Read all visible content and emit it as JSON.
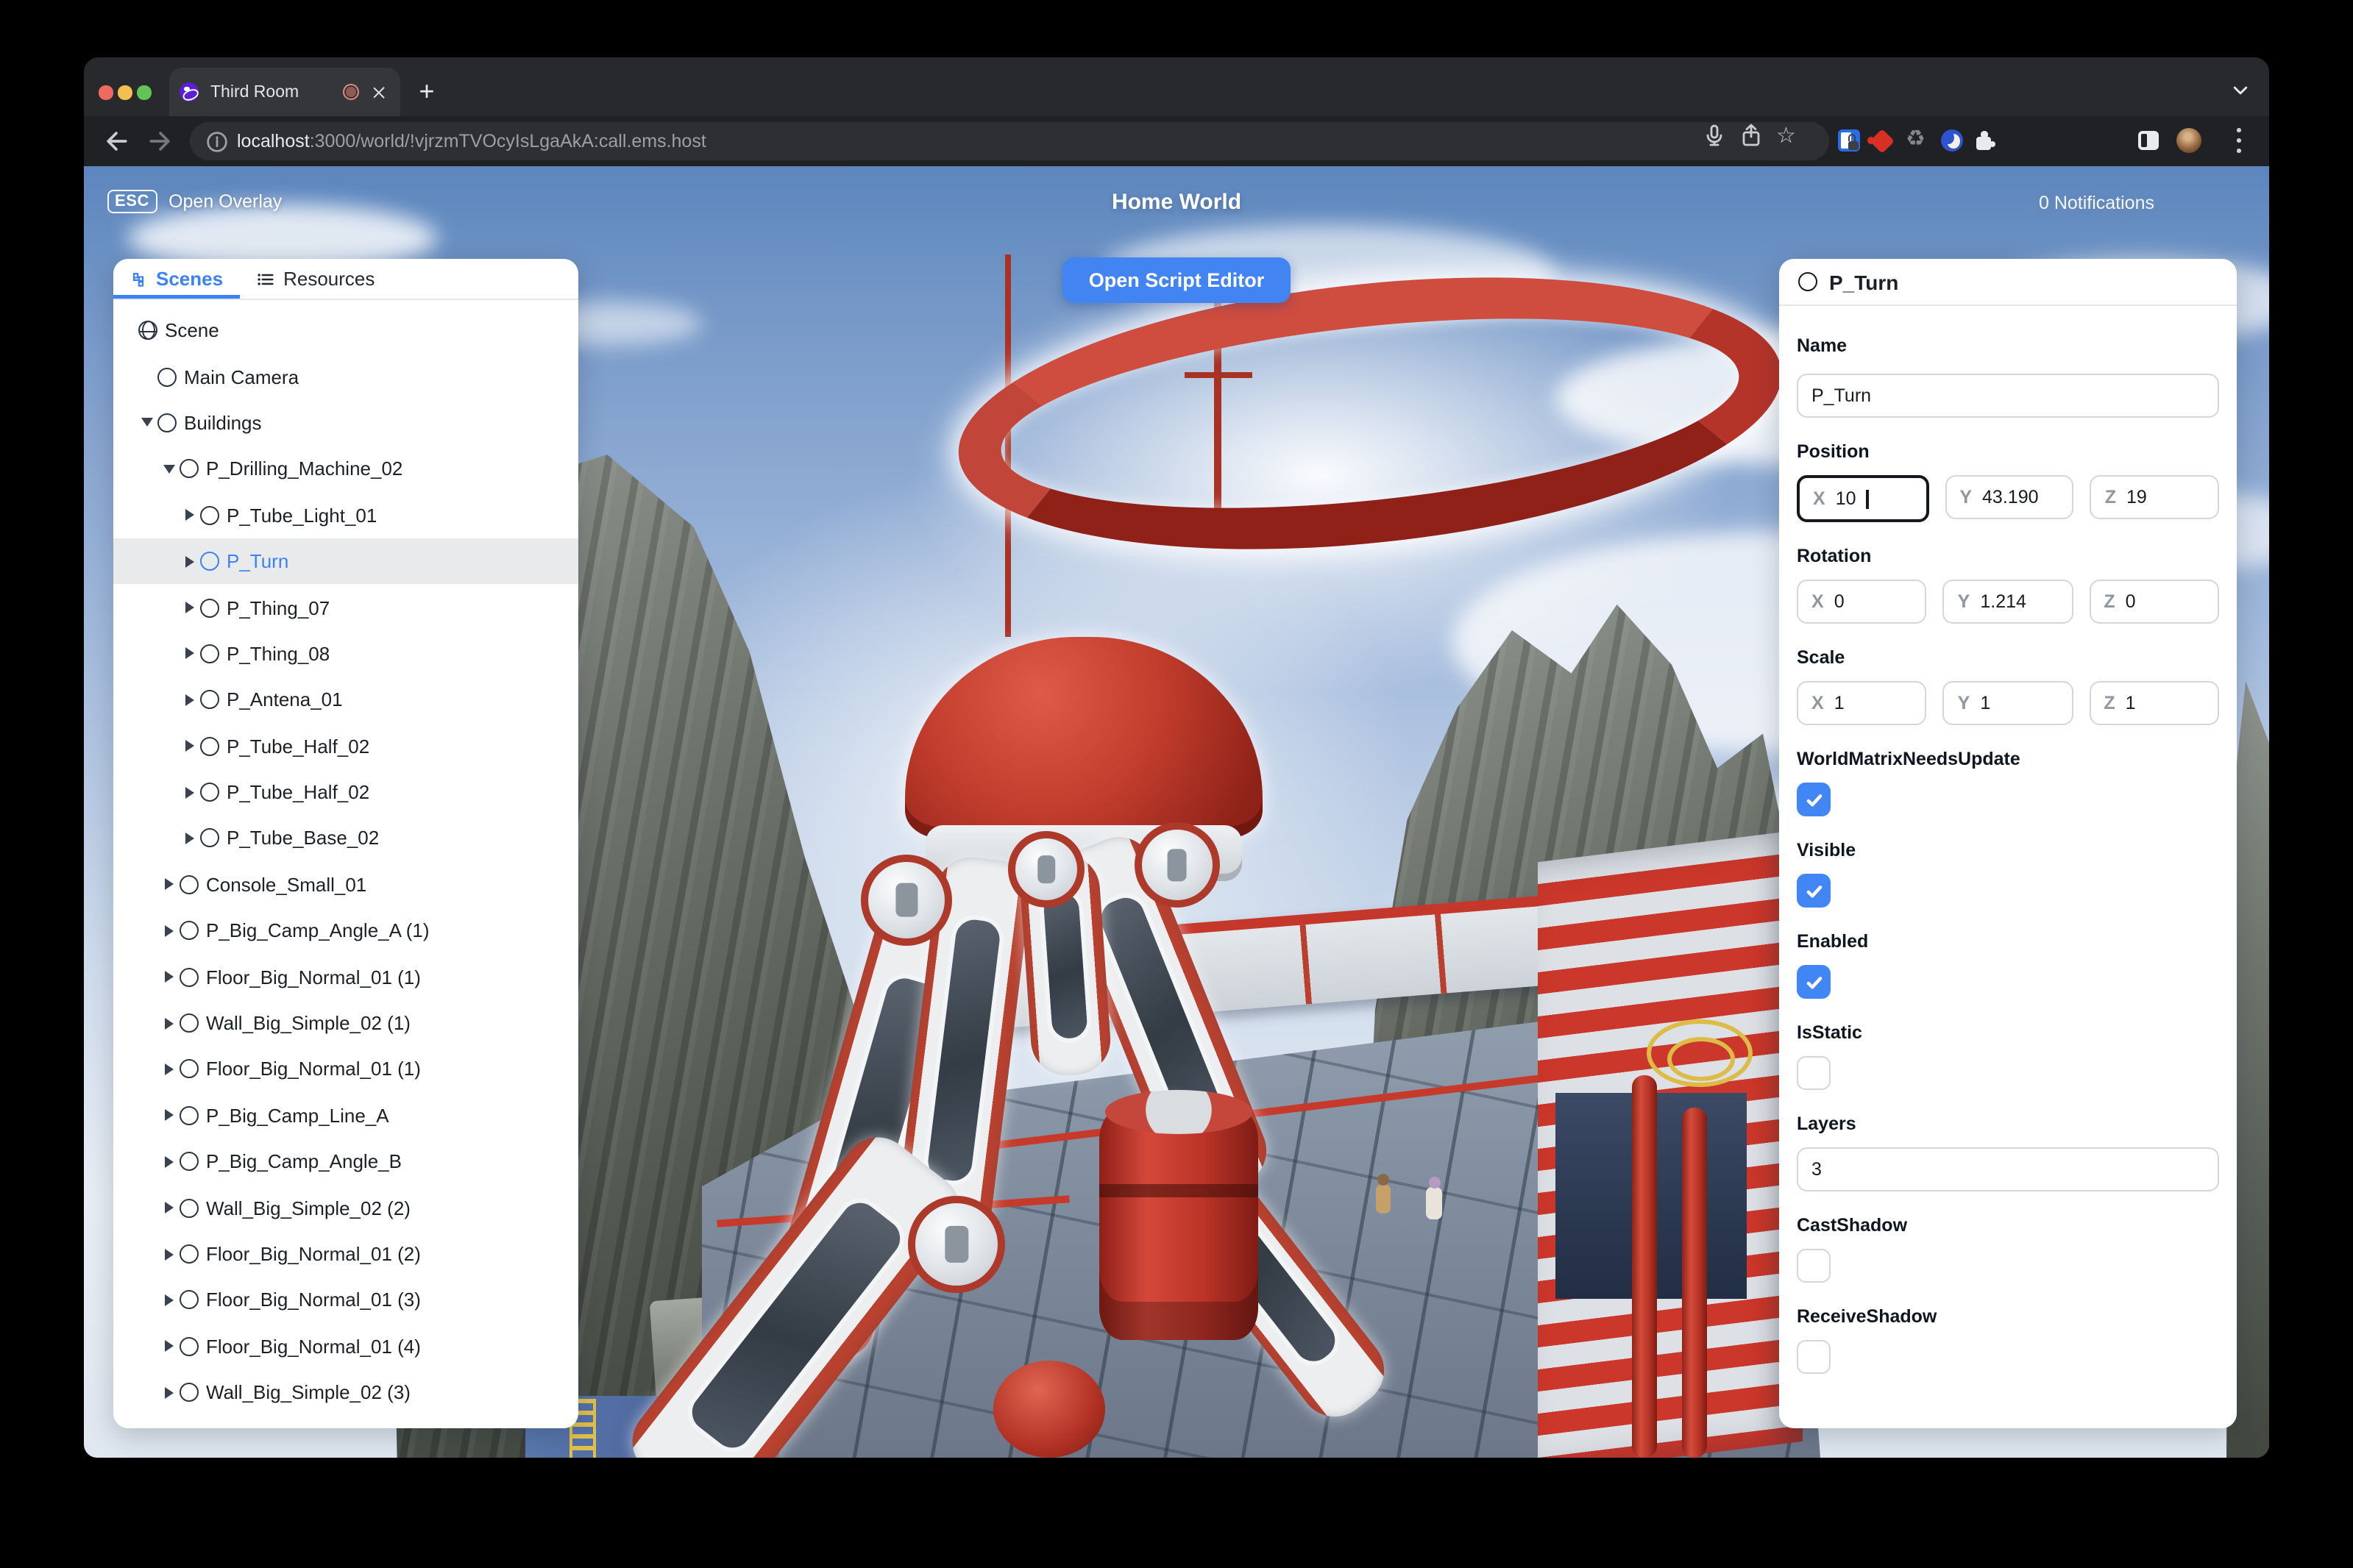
{
  "browser": {
    "tab_title": "Third Room",
    "new_tab_label": "+",
    "url": {
      "host": "localhost",
      "path": ":3000/world/!vjrzmTVOcyIsLgaAkA:call.ems.host"
    },
    "toolbar_icons": [
      "back-icon",
      "forward-icon",
      "reload-icon",
      "site-info-icon",
      "mic-icon",
      "share-icon",
      "bookmark-star-icon",
      "password-manager-extension-icon",
      "red-extension-icon",
      "recycle-extension-icon",
      "dark-mode-extension-icon",
      "extensions-puzzle-icon",
      "side-panel-icon",
      "profile-avatar",
      "menu-kebab-icon"
    ]
  },
  "overlay": {
    "esc_key": "ESC",
    "open_overlay": "Open Overlay",
    "world_title": "Home World",
    "notifications": "0 Notifications",
    "open_script_editor": "Open Script Editor"
  },
  "sidebar": {
    "tabs": [
      {
        "label": "Scenes",
        "active": true
      },
      {
        "label": "Resources",
        "active": false
      }
    ],
    "tree": [
      {
        "label": "Scene",
        "level": 0,
        "icon": "globe",
        "caret": "",
        "selected": false
      },
      {
        "label": "Main Camera",
        "level": 1,
        "icon": "circle",
        "caret": "",
        "selected": false
      },
      {
        "label": "Buildings",
        "level": 1,
        "icon": "circle",
        "caret": "down",
        "selected": false
      },
      {
        "label": "P_Drilling_Machine_02",
        "level": 2,
        "icon": "circle",
        "caret": "down",
        "selected": false
      },
      {
        "label": "P_Tube_Light_01",
        "level": 3,
        "icon": "circle",
        "caret": "right",
        "selected": false
      },
      {
        "label": "P_Turn",
        "level": 3,
        "icon": "circle",
        "caret": "right",
        "selected": true
      },
      {
        "label": "P_Thing_07",
        "level": 3,
        "icon": "circle",
        "caret": "right",
        "selected": false
      },
      {
        "label": "P_Thing_08",
        "level": 3,
        "icon": "circle",
        "caret": "right",
        "selected": false
      },
      {
        "label": "P_Antena_01",
        "level": 3,
        "icon": "circle",
        "caret": "right",
        "selected": false
      },
      {
        "label": "P_Tube_Half_02",
        "level": 3,
        "icon": "circle",
        "caret": "right",
        "selected": false
      },
      {
        "label": "P_Tube_Half_02",
        "level": 3,
        "icon": "circle",
        "caret": "right",
        "selected": false
      },
      {
        "label": "P_Tube_Base_02",
        "level": 3,
        "icon": "circle",
        "caret": "right",
        "selected": false
      },
      {
        "label": "Console_Small_01",
        "level": 2,
        "icon": "circle",
        "caret": "right",
        "selected": false
      },
      {
        "label": "P_Big_Camp_Angle_A (1)",
        "level": 2,
        "icon": "circle",
        "caret": "right",
        "selected": false
      },
      {
        "label": "Floor_Big_Normal_01 (1)",
        "level": 2,
        "icon": "circle",
        "caret": "right",
        "selected": false
      },
      {
        "label": "Wall_Big_Simple_02 (1)",
        "level": 2,
        "icon": "circle",
        "caret": "right",
        "selected": false
      },
      {
        "label": "Floor_Big_Normal_01 (1)",
        "level": 2,
        "icon": "circle",
        "caret": "right",
        "selected": false
      },
      {
        "label": "P_Big_Camp_Line_A",
        "level": 2,
        "icon": "circle",
        "caret": "right",
        "selected": false
      },
      {
        "label": "P_Big_Camp_Angle_B",
        "level": 2,
        "icon": "circle",
        "caret": "right",
        "selected": false
      },
      {
        "label": "Wall_Big_Simple_02 (2)",
        "level": 2,
        "icon": "circle",
        "caret": "right",
        "selected": false
      },
      {
        "label": "Floor_Big_Normal_01 (2)",
        "level": 2,
        "icon": "circle",
        "caret": "right",
        "selected": false
      },
      {
        "label": "Floor_Big_Normal_01 (3)",
        "level": 2,
        "icon": "circle",
        "caret": "right",
        "selected": false
      },
      {
        "label": "Floor_Big_Normal_01 (4)",
        "level": 2,
        "icon": "circle",
        "caret": "right",
        "selected": false
      },
      {
        "label": "Wall_Big_Simple_02 (3)",
        "level": 2,
        "icon": "circle",
        "caret": "right",
        "selected": false
      }
    ]
  },
  "inspector": {
    "title": "P_Turn",
    "axis": {
      "x": "X",
      "y": "Y",
      "z": "Z"
    },
    "name": {
      "label": "Name",
      "value": "P_Turn"
    },
    "position": {
      "label": "Position",
      "x": "10",
      "y": "43.190",
      "z": "19"
    },
    "rotation": {
      "label": "Rotation",
      "x": "0",
      "y": "1.214",
      "z": "0"
    },
    "scale": {
      "label": "Scale",
      "x": "1",
      "y": "1",
      "z": "1"
    },
    "flags": [
      {
        "label": "WorldMatrixNeedsUpdate",
        "checked": true
      },
      {
        "label": "Visible",
        "checked": true
      },
      {
        "label": "Enabled",
        "checked": true
      },
      {
        "label": "IsStatic",
        "checked": false
      }
    ],
    "layers": {
      "label": "Layers",
      "value": "3"
    },
    "shadow_flags": [
      {
        "label": "CastShadow",
        "checked": false
      },
      {
        "label": "ReceiveShadow",
        "checked": false
      }
    ]
  },
  "colors": {
    "accent_blue": "#3b82f6",
    "checkbox_blue": "#4285f4",
    "button_blue": "#4285f2",
    "machine_red": "#b5342a"
  }
}
